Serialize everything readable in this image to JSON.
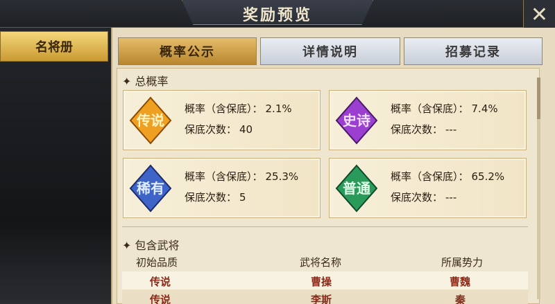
{
  "header": {
    "title": "奖励预览",
    "close_label": "✕"
  },
  "sidebar": {
    "items": [
      {
        "label": "名将册"
      }
    ]
  },
  "tabs": [
    {
      "label": "概率公示",
      "active": true
    },
    {
      "label": "详情说明",
      "active": false
    },
    {
      "label": "招募记录",
      "active": false
    }
  ],
  "overall": {
    "section_label": "总概率",
    "cards": [
      {
        "badge": "传说",
        "badge_icon": "legendary-badge-icon",
        "color": "#f0a020",
        "prob_label": "概率（含保底）：",
        "prob": "2.1%",
        "pity_label": "保底次数：",
        "pity": "40"
      },
      {
        "badge": "史诗",
        "badge_icon": "epic-badge-icon",
        "color": "#9a3fd0",
        "prob_label": "概率（含保底）：",
        "prob": "7.4%",
        "pity_label": "保底次数：",
        "pity": "---"
      },
      {
        "badge": "稀有",
        "badge_icon": "rare-badge-icon",
        "color": "#3f64c8",
        "prob_label": "概率（含保底）：",
        "prob": "25.3%",
        "pity_label": "保底次数：",
        "pity": "5"
      },
      {
        "badge": "普通",
        "badge_icon": "common-badge-icon",
        "color": "#2a9a5a",
        "prob_label": "概率（含保底）：",
        "prob": "65.2%",
        "pity_label": "保底次数：",
        "pity": "---"
      }
    ]
  },
  "generals": {
    "section_label": "包含武将",
    "columns": [
      "初始品质",
      "武将名称",
      "所属势力"
    ],
    "rows": [
      [
        "传说",
        "曹操",
        "曹魏"
      ],
      [
        "传说",
        "李斯",
        "秦"
      ]
    ]
  },
  "colors": {
    "accent": "#c99a32",
    "rarity_text": "#8a2b1a"
  }
}
